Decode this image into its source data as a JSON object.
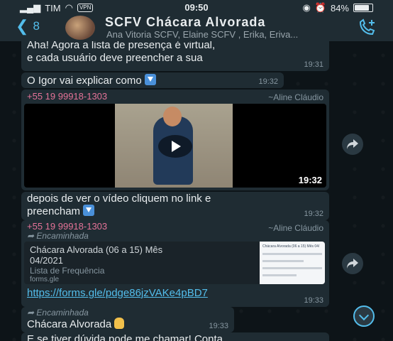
{
  "status_bar": {
    "carrier": "TIM",
    "vpn": "VPN",
    "time": "09:50",
    "battery": "84%",
    "battery_level": 0.84
  },
  "header": {
    "back_count": "8",
    "title": "SCFV Chácara Alvorada",
    "members": "Ana Vitoria SCFV, Elaine SCFV , Erika, Eriva..."
  },
  "messages": [
    {
      "text_line1": "Aha! Agora a lista de presença é virtual,",
      "text_line2": "e cada usuário deve preencher a sua",
      "time": "19:31"
    },
    {
      "text": "O Igor vai explicar como",
      "time": "19:32"
    },
    {
      "sender_phone": "+55 19 99918-1303",
      "sender_name": "~Aline Cláudio",
      "video_time": "19:32"
    },
    {
      "text_line1": "depois de ver o vídeo cliquem no link e",
      "text_line2": "preencham",
      "time": "19:32"
    },
    {
      "sender_phone": "+55 19 99918-1303",
      "sender_name": "~Aline Cláudio",
      "forwarded": "Encaminhada",
      "preview_title_line1": "Chácara Alvorada (06 a 15) Mês",
      "preview_title_line2": "04/2021",
      "preview_desc": "Lista de Frequência",
      "preview_domain": "forms.gle",
      "thumb_text": "Chácara Alvorada (06 a 15) Mês 04/",
      "url": "https://forms.gle/pdge86jzVAKe4pBD7",
      "time": "19:33"
    },
    {
      "forwarded": "Encaminhada",
      "text": "Chácara Alvorada",
      "time": "19:33"
    },
    {
      "text": "E se tiver dúvida pode me chamar! Conta"
    }
  ],
  "colors": {
    "accent": "#53bdeb",
    "sender": "#e57398",
    "bubble": "#1f2c33"
  }
}
